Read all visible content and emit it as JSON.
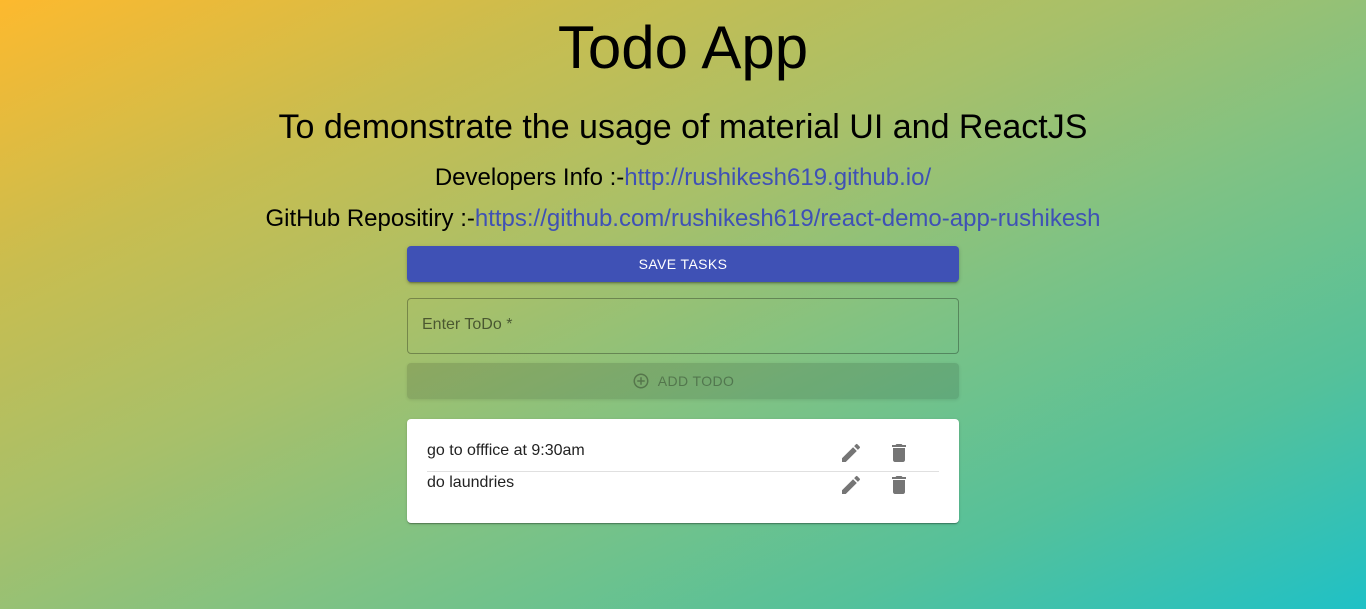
{
  "header": {
    "title": "Todo App",
    "subtitle": "To demonstrate the usage of material UI and ReactJS",
    "developer_label": "Developers Info :-",
    "developer_link": "http://rushikesh619.github.io/",
    "repo_label": "GitHub Repositiry :-",
    "repo_link": "https://github.com/rushikesh619/react-demo-app-rushikesh"
  },
  "actions": {
    "save_label": "SAVE TASKS",
    "add_label": "ADD TODO"
  },
  "todo_input": {
    "label": "Enter ToDo *",
    "value": ""
  },
  "todos": [
    {
      "text": "go to offfice at 9:30am"
    },
    {
      "text": "do laundries"
    }
  ],
  "colors": {
    "primary": "#3f51b5",
    "icon": "#757575",
    "gradient_start": "#fdb92e",
    "gradient_end": "#1fc1c6"
  }
}
